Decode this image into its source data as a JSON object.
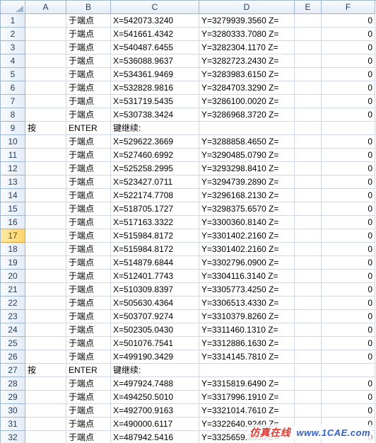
{
  "columns": [
    "A",
    "B",
    "C",
    "D",
    "E",
    "F"
  ],
  "active_row": 17,
  "watermark": {
    "label": "仿真在线",
    "url": "www.1CAE.com"
  },
  "rows": [
    {
      "n": 1,
      "a": "",
      "b": "于端点",
      "c": "X=542073.3240",
      "d": "Y=3279939.3560 Z=",
      "e": "",
      "f": "0"
    },
    {
      "n": 2,
      "a": "",
      "b": "于端点",
      "c": "X=541661.4342",
      "d": "Y=3280333.7080 Z=",
      "e": "",
      "f": "0"
    },
    {
      "n": 3,
      "a": "",
      "b": "于端点",
      "c": "X=540487.6455",
      "d": "Y=3282304.1170 Z=",
      "e": "",
      "f": "0"
    },
    {
      "n": 4,
      "a": "",
      "b": "于端点",
      "c": "X=536088.9637",
      "d": "Y=3282723.2430 Z=",
      "e": "",
      "f": "0"
    },
    {
      "n": 5,
      "a": "",
      "b": "于端点",
      "c": "X=534361.9469",
      "d": "Y=3283983.6150 Z=",
      "e": "",
      "f": "0"
    },
    {
      "n": 6,
      "a": "",
      "b": "于端点",
      "c": "X=532828.9816",
      "d": "Y=3284703.3290 Z=",
      "e": "",
      "f": "0"
    },
    {
      "n": 7,
      "a": "",
      "b": "于端点",
      "c": "X=531719.5435",
      "d": "Y=3286100.0020 Z=",
      "e": "",
      "f": "0"
    },
    {
      "n": 8,
      "a": "",
      "b": "于端点",
      "c": "X=530738.3424",
      "d": "Y=3286968.3720 Z=",
      "e": "",
      "f": "0"
    },
    {
      "n": 9,
      "a": "按",
      "b": "ENTER",
      "c": "键继续:",
      "d": "",
      "e": "",
      "f": ""
    },
    {
      "n": 10,
      "a": "",
      "b": "于端点",
      "c": "X=529622.3669",
      "d": "Y=3288858.4650 Z=",
      "e": "",
      "f": "0"
    },
    {
      "n": 11,
      "a": "",
      "b": "于端点",
      "c": "X=527460.6992",
      "d": "Y=3290485.0790 Z=",
      "e": "",
      "f": "0"
    },
    {
      "n": 12,
      "a": "",
      "b": "于端点",
      "c": "X=525258.2995",
      "d": "Y=3293298.8410 Z=",
      "e": "",
      "f": "0"
    },
    {
      "n": 13,
      "a": "",
      "b": "于端点",
      "c": "X=523427.0711",
      "d": "Y=3294739.2890 Z=",
      "e": "",
      "f": "0"
    },
    {
      "n": 14,
      "a": "",
      "b": "于端点",
      "c": "X=522174.7708",
      "d": "Y=3296168.2130 Z=",
      "e": "",
      "f": "0"
    },
    {
      "n": 15,
      "a": "",
      "b": "于端点",
      "c": "X=518705.1727",
      "d": "Y=3298375.6570 Z=",
      "e": "",
      "f": "0"
    },
    {
      "n": 16,
      "a": "",
      "b": "于端点",
      "c": "X=517163.3322",
      "d": "Y=3300360.8140 Z=",
      "e": "",
      "f": "0"
    },
    {
      "n": 17,
      "a": "",
      "b": "于端点",
      "c": "X=515984.8172",
      "d": "Y=3301402.2160 Z=",
      "e": "",
      "f": "0"
    },
    {
      "n": 18,
      "a": "",
      "b": "于端点",
      "c": "X=515984.8172",
      "d": "Y=3301402.2160 Z=",
      "e": "",
      "f": "0"
    },
    {
      "n": 19,
      "a": "",
      "b": "于端点",
      "c": "X=514879.6844",
      "d": "Y=3302796.0900 Z=",
      "e": "",
      "f": "0"
    },
    {
      "n": 20,
      "a": "",
      "b": "于端点",
      "c": "X=512401.7743",
      "d": "Y=3304116.3140 Z=",
      "e": "",
      "f": "0"
    },
    {
      "n": 21,
      "a": "",
      "b": "于端点",
      "c": "X=510309.8397",
      "d": "Y=3305773.4250 Z=",
      "e": "",
      "f": "0"
    },
    {
      "n": 22,
      "a": "",
      "b": "于端点",
      "c": "X=505630.4364",
      "d": "Y=3306513.4330 Z=",
      "e": "",
      "f": "0"
    },
    {
      "n": 23,
      "a": "",
      "b": "于端点",
      "c": "X=503707.9274",
      "d": "Y=3310379.8260 Z=",
      "e": "",
      "f": "0"
    },
    {
      "n": 24,
      "a": "",
      "b": "于端点",
      "c": "X=502305.0430",
      "d": "Y=3311460.1310 Z=",
      "e": "",
      "f": "0"
    },
    {
      "n": 25,
      "a": "",
      "b": "于端点",
      "c": "X=501076.7541",
      "d": "Y=3312886.1630 Z=",
      "e": "",
      "f": "0"
    },
    {
      "n": 26,
      "a": "",
      "b": "于端点",
      "c": "X=499190.3429",
      "d": "Y=3314145.7810 Z=",
      "e": "",
      "f": "0"
    },
    {
      "n": 27,
      "a": "按",
      "b": "ENTER",
      "c": "键继续:",
      "d": "",
      "e": "",
      "f": ""
    },
    {
      "n": 28,
      "a": "",
      "b": "于端点",
      "c": "X=497924.7488",
      "d": "Y=3315819.6490 Z=",
      "e": "",
      "f": "0"
    },
    {
      "n": 29,
      "a": "",
      "b": "于端点",
      "c": "X=494250.5010",
      "d": "Y=3317996.1910 Z=",
      "e": "",
      "f": "0"
    },
    {
      "n": 30,
      "a": "",
      "b": "于端点",
      "c": "X=492700.9163",
      "d": "Y=3321014.7610 Z=",
      "e": "",
      "f": "0"
    },
    {
      "n": 31,
      "a": "",
      "b": "于端点",
      "c": "X=490000.6117",
      "d": "Y=3322640.9240 Z=",
      "e": "",
      "f": "0"
    },
    {
      "n": 32,
      "a": "",
      "b": "于端点",
      "c": "X=487942.5416",
      "d": "Y=3325659.3650 Z=",
      "e": "",
      "f": "0"
    }
  ]
}
